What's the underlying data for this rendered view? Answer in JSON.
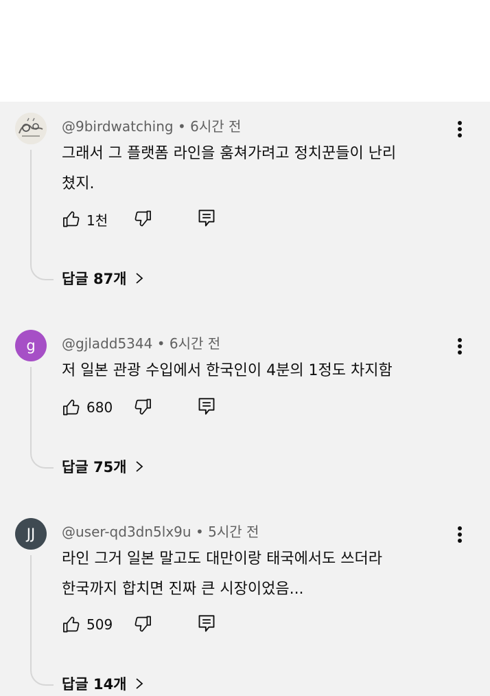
{
  "comments": [
    {
      "author": "@9birdwatching",
      "time": "• 6시간 전",
      "text": "그래서 그 플랫폼 라인을 훔쳐가려고 정치꾼들이 난리\n쳤지.",
      "likes": "1천",
      "replies": "답글 87개",
      "avatar": {
        "type": "image",
        "icon": "sketch-avatar-icon"
      }
    },
    {
      "author": "@gjladd5344",
      "time": "• 6시간 전",
      "text": "저 일본 관광 수입에서 한국인이 4분의 1정도 차지함",
      "likes": "680",
      "replies": "답글 75개",
      "avatar": {
        "type": "letter",
        "letter": "g",
        "color": "#a64fc6"
      }
    },
    {
      "author": "@user-qd3dn5lx9u",
      "time": "• 5시간 전",
      "text": "라인 그거 일본 말고도 대만이랑 태국에서도 쓰더라\n한국까지 합치면 진짜 큰 시장이었음...",
      "likes": "509",
      "replies": "답글 14개",
      "avatar": {
        "type": "letter",
        "letter": "JJ",
        "color": "#3f4a52"
      }
    }
  ],
  "icons": {
    "like": "thumbs-up-icon",
    "dislike": "thumbs-down-icon",
    "reply": "reply-icon",
    "more": "more-vert-icon",
    "chevron": "chevron-right-icon"
  },
  "colors": {
    "panel_bg": "#f2f2f2",
    "meta_text": "#606060",
    "primary_text": "#0f0f0f"
  }
}
